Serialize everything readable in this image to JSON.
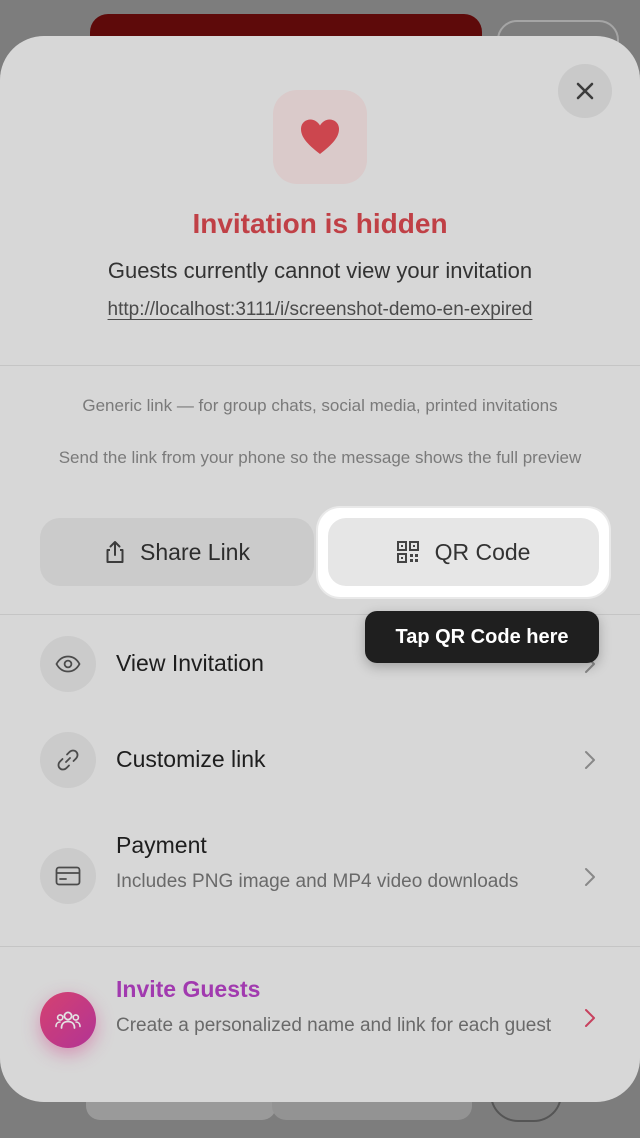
{
  "header": {
    "title": "Invitation is hidden",
    "subtitle": "Guests currently cannot view your invitation",
    "url": "http://localhost:3111/i/screenshot-demo-en-expired"
  },
  "share": {
    "note_generic": "Generic link — for group chats, social media, printed invitations",
    "note_phone": "Send the link from your phone so the message shows the full preview",
    "share_label": "Share Link",
    "qr_label": "QR Code",
    "tooltip": "Tap QR Code here"
  },
  "menu": {
    "view": {
      "title": "View Invitation"
    },
    "customize": {
      "title": "Customize link"
    },
    "payment": {
      "title": "Payment",
      "desc": "Includes PNG image and MP4 video downloads"
    },
    "invite": {
      "title": "Invite Guests",
      "desc": "Create a personalized name and link for each guest"
    }
  },
  "icons": {
    "close": "close-icon",
    "heart": "heart-icon",
    "share": "share-icon",
    "qr": "qr-code-icon",
    "eye": "eye-icon",
    "link": "link-icon",
    "card": "credit-card-icon",
    "users": "users-icon",
    "chevron": "chevron-right-icon"
  },
  "colors": {
    "accent_red": "#d8484f",
    "invite_purple": "#b542c5",
    "invite_gradient_start": "#f04a7e",
    "invite_gradient_end": "#c83aa8",
    "tooltip_bg": "#1f1f1f"
  }
}
